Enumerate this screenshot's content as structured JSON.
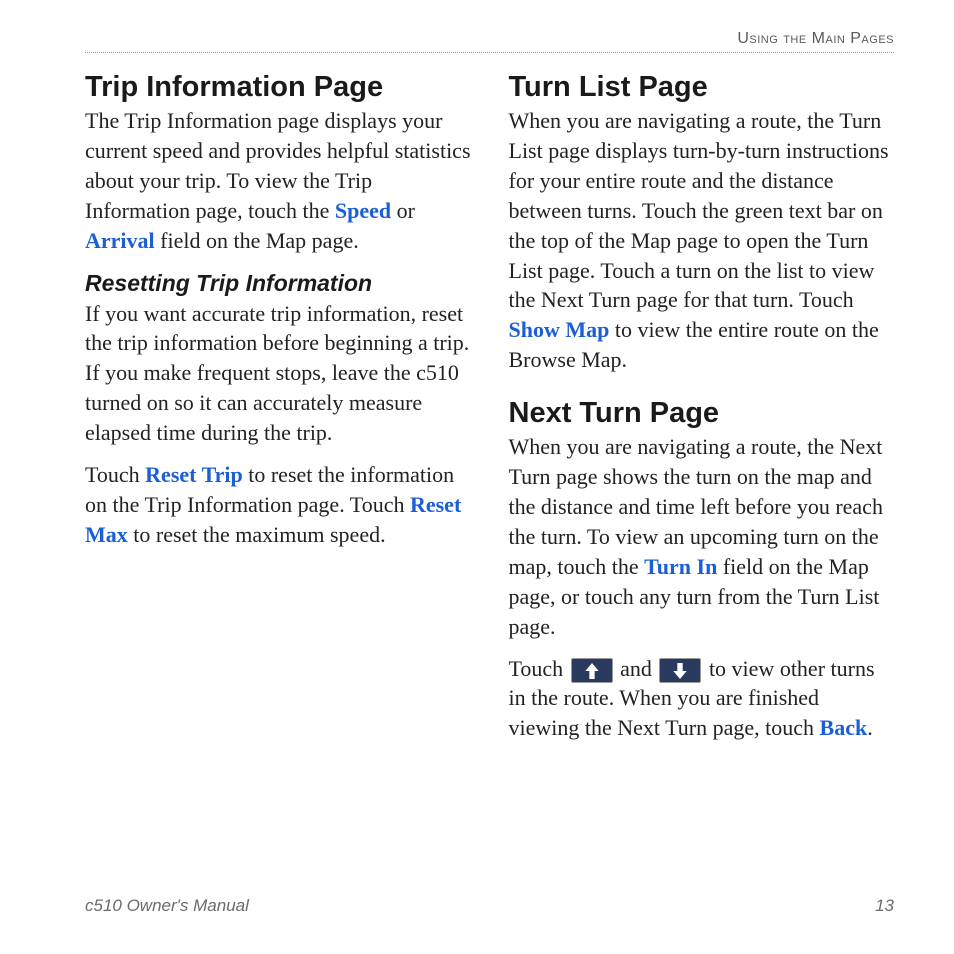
{
  "header": {
    "running_head": "Using the Main Pages"
  },
  "left": {
    "h2": "Trip Information Page",
    "p1a": "The Trip Information page displays your current speed and provides helpful statistics about your trip. To view the Trip Information page, touch the ",
    "p1_speed": "Speed",
    "p1b": " or ",
    "p1_arrival": "Arrival",
    "p1c": " field on the Map page.",
    "h3": "Resetting Trip Information",
    "p2": "If you want accurate trip information, reset the trip information before beginning a trip. If you make frequent stops, leave the c510 turned on so it can accurately measure elapsed time during the trip.",
    "p3a": "Touch ",
    "p3_reset_trip": "Reset Trip",
    "p3b": " to reset the information on the Trip Information page. Touch ",
    "p3_reset_max": "Reset Max",
    "p3c": " to reset the maximum speed."
  },
  "right": {
    "h2a": "Turn List Page",
    "p1a": "When you are navigating a route, the Turn List page displays turn-by-turn instructions for your entire route and the distance between turns. Touch the green text bar on the top of the Map page to open the Turn List page. Touch a turn on the list to view the Next Turn page for that turn. Touch ",
    "p1_show_map": "Show Map",
    "p1b": " to view the entire route on the Browse Map.",
    "h2b": "Next Turn Page",
    "p2a": "When you are navigating a route, the Next Turn page shows the turn on the map and the distance and time left before you reach the turn. To view an upcoming turn on the map, touch the ",
    "p2_turn_in": "Turn In",
    "p2b": " field on the Map page, or touch any turn from the Turn List page.",
    "p3a": "Touch ",
    "p3b": " and ",
    "p3c": " to view other turns in the route. When you are finished viewing the Next Turn page, touch ",
    "p3_back": "Back",
    "p3d": "."
  },
  "footer": {
    "manual": "c510 Owner's Manual",
    "page": "13"
  }
}
